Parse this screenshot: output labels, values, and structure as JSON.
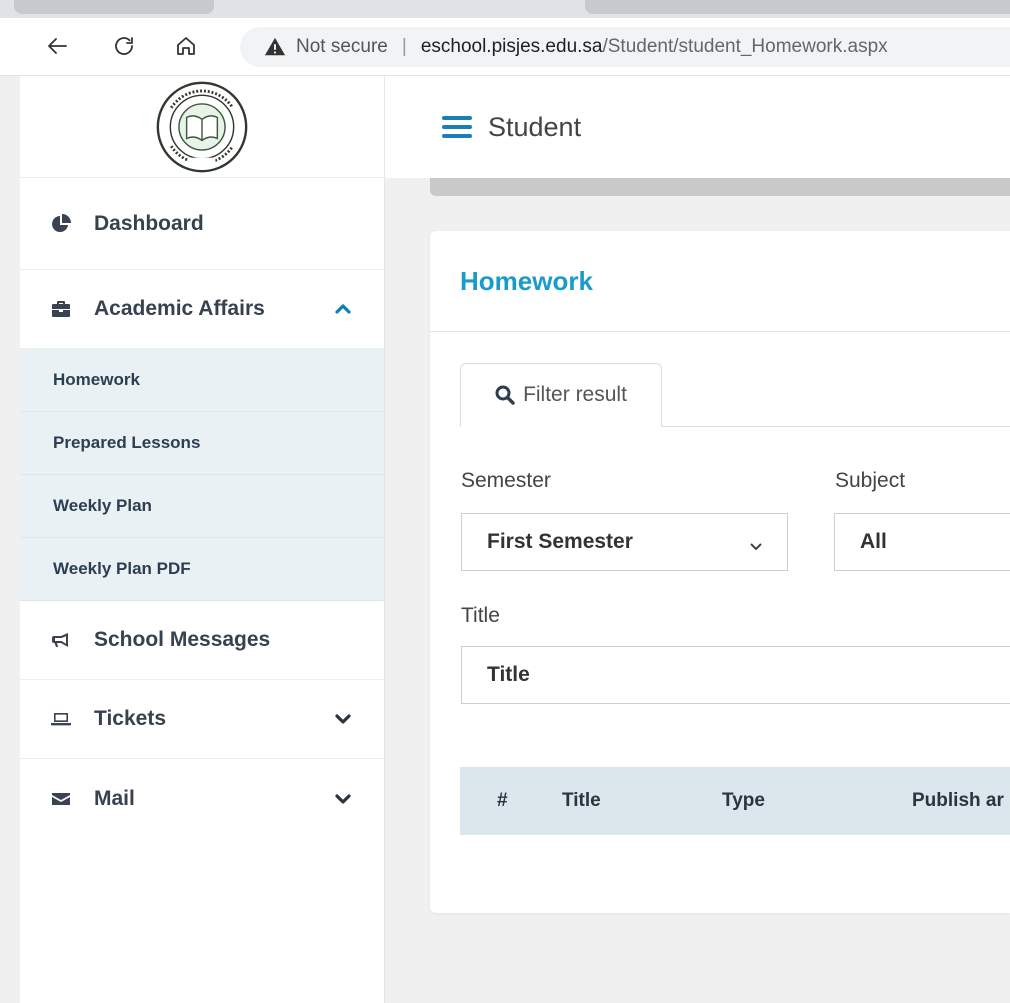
{
  "browser": {
    "not_secure_label": "Not secure",
    "url_host": "eschool.pisjes.edu.sa",
    "url_path": "/Student/student_Homework.aspx"
  },
  "sidebar": {
    "logo_alt": "Pakistan International School Jeddah",
    "dashboard": "Dashboard",
    "academic": {
      "label": "Academic Affairs",
      "children": [
        "Homework",
        "Prepared Lessons",
        "Weekly Plan",
        "Weekly Plan PDF"
      ]
    },
    "school_messages": "School Messages",
    "tickets": "Tickets",
    "mail": "Mail"
  },
  "topbar": {
    "title": "Student"
  },
  "card": {
    "title": "Homework",
    "filter_tab": "Filter result",
    "semester_label": "Semester",
    "semester_value": "First Semester",
    "subject_label": "Subject",
    "subject_value": "All",
    "title_label": "Title",
    "title_placeholder": "Title"
  },
  "table": {
    "columns": [
      "#",
      "Title",
      "Type",
      "Publish ar"
    ]
  },
  "colors": {
    "accent": "#1a9bc9",
    "submenu_bg": "#e9f1f5",
    "table_header_bg": "#dce6ed"
  }
}
